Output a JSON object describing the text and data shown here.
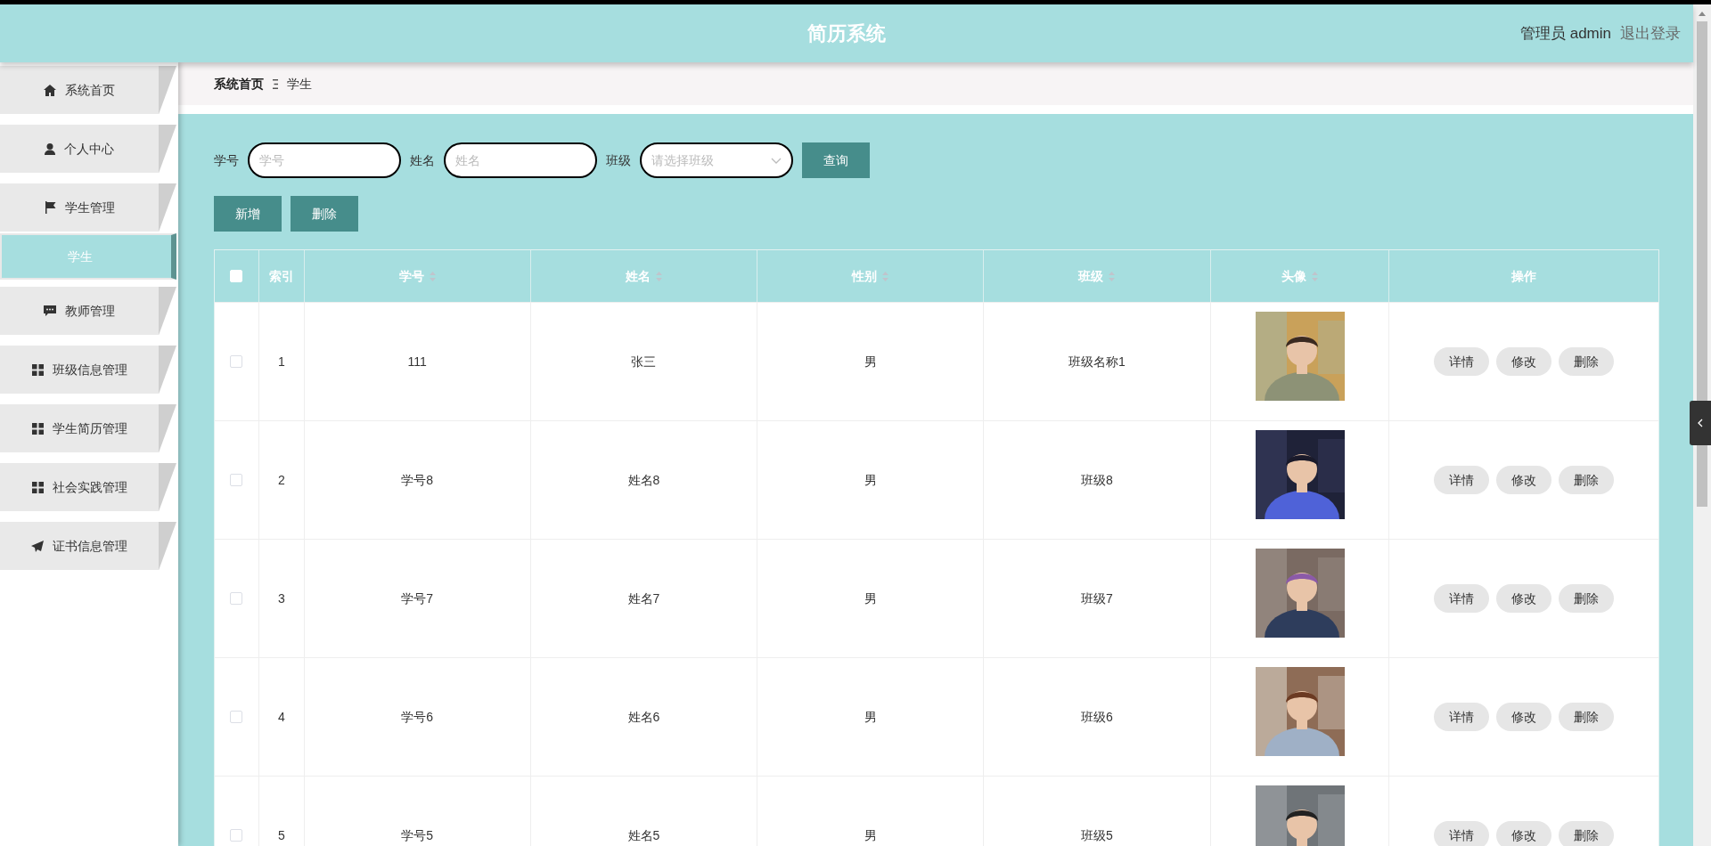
{
  "header": {
    "title": "简历系统",
    "user": "管理员 admin",
    "logout": "退出登录"
  },
  "sidebar": {
    "items": [
      {
        "label": "系统首页",
        "selected": false
      },
      {
        "label": "个人中心",
        "selected": false
      },
      {
        "label": "学生管理",
        "selected": false,
        "children": [
          {
            "label": "学生",
            "selected": true
          }
        ]
      },
      {
        "label": "教师管理",
        "selected": false
      },
      {
        "label": "班级信息管理",
        "selected": false
      },
      {
        "label": "学生简历管理",
        "selected": false
      },
      {
        "label": "社会实践管理",
        "selected": false
      },
      {
        "label": "证书信息管理",
        "selected": false
      }
    ]
  },
  "breadcrumb": [
    "系统首页",
    "学生"
  ],
  "search": {
    "fields": [
      {
        "kind": "text",
        "label": "学号",
        "placeholder": "学号"
      },
      {
        "kind": "text",
        "label": "姓名",
        "placeholder": "姓名"
      },
      {
        "kind": "select",
        "label": "班级",
        "placeholder": "请选择班级"
      }
    ],
    "button": "查询"
  },
  "actions": [
    "新增",
    "删除"
  ],
  "table": {
    "header_checkbox": {
      "checked": false
    },
    "columns": [
      {
        "label": "索引",
        "sortable": false
      },
      {
        "label": "学号",
        "sortable": true
      },
      {
        "label": "姓名",
        "sortable": true
      },
      {
        "label": "性别",
        "sortable": true
      },
      {
        "label": "班级",
        "sortable": true
      },
      {
        "label": "头像",
        "sortable": true
      },
      {
        "label": "操作",
        "sortable": false
      }
    ],
    "rows": [
      {
        "checked": false,
        "cells": [
          "1",
          "111",
          "张三",
          "男",
          "班级名称1"
        ],
        "buttons": [
          "详情",
          "修改",
          "删除"
        ]
      },
      {
        "checked": false,
        "cells": [
          "2",
          "学号8",
          "姓名8",
          "男",
          "班级8"
        ],
        "buttons": [
          "详情",
          "修改",
          "删除"
        ]
      },
      {
        "checked": false,
        "cells": [
          "3",
          "学号7",
          "姓名7",
          "男",
          "班级7"
        ],
        "buttons": [
          "详情",
          "修改",
          "删除"
        ]
      },
      {
        "checked": false,
        "cells": [
          "4",
          "学号6",
          "姓名6",
          "男",
          "班级6"
        ],
        "buttons": [
          "详情",
          "修改",
          "删除"
        ]
      },
      {
        "checked": false,
        "cells": [
          "5",
          "学号5",
          "姓名5",
          "男",
          "班级5"
        ],
        "buttons": [
          "详情",
          "修改",
          "删除"
        ]
      }
    ]
  }
}
